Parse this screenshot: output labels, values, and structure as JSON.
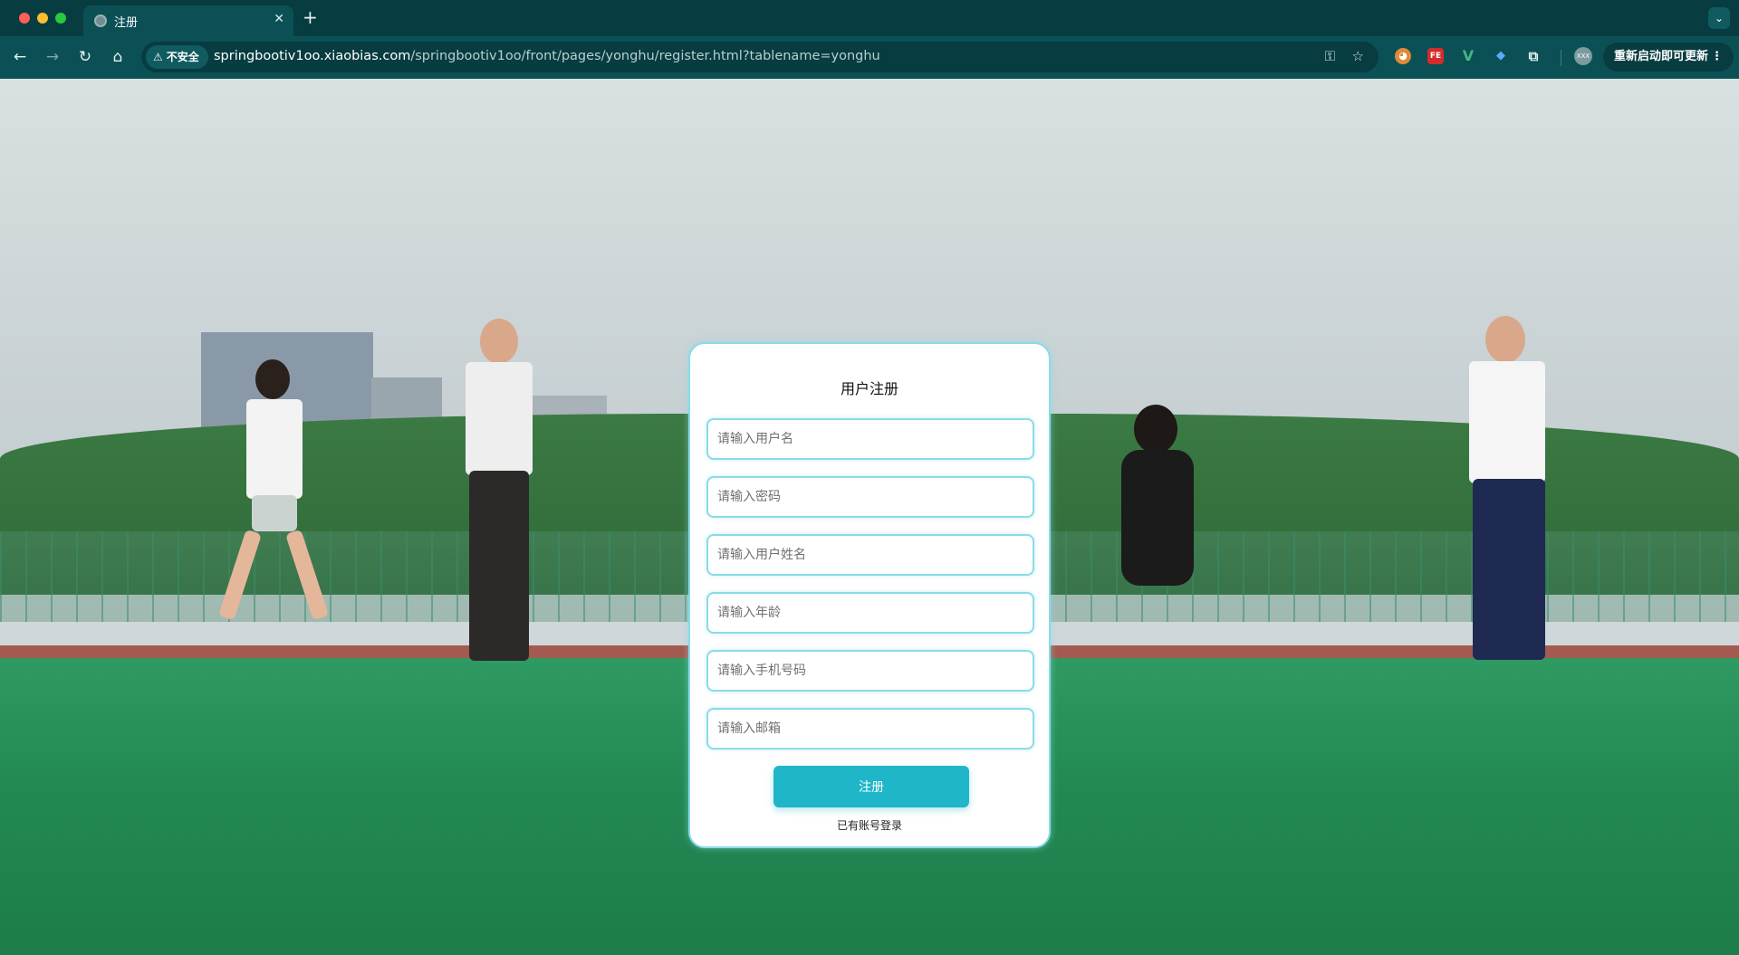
{
  "browser": {
    "tab_title": "注册",
    "new_tab_symbol": "+",
    "tab_close_symbol": "✕",
    "security_label": "不安全",
    "url_host": "springbootiv1oo.xiaobias.com",
    "url_path": "/springbootiv1oo/front/pages/yonghu/register.html?tablename=yonghu",
    "update_label": "重新启动即可更新",
    "extensions": [
      "cookie-extension-icon",
      "fe-helper-icon",
      "vue-devtools-icon",
      "gem-extension-icon",
      "puzzle-extensions-icon"
    ],
    "profile_text": "XXX"
  },
  "register": {
    "title": "用户注册",
    "fields": [
      {
        "name": "username",
        "placeholder": "请输入用户名"
      },
      {
        "name": "password",
        "placeholder": "请输入密码"
      },
      {
        "name": "fullname",
        "placeholder": "请输入用户姓名"
      },
      {
        "name": "age",
        "placeholder": "请输入年龄"
      },
      {
        "name": "phone",
        "placeholder": "请输入手机号码"
      },
      {
        "name": "email",
        "placeholder": "请输入邮箱"
      }
    ],
    "submit_label": "注册",
    "login_link": "已有账号登录"
  },
  "colors": {
    "accent": "#1fb6c9",
    "input_border": "#8adce6",
    "chrome_bg": "#0b5055"
  }
}
